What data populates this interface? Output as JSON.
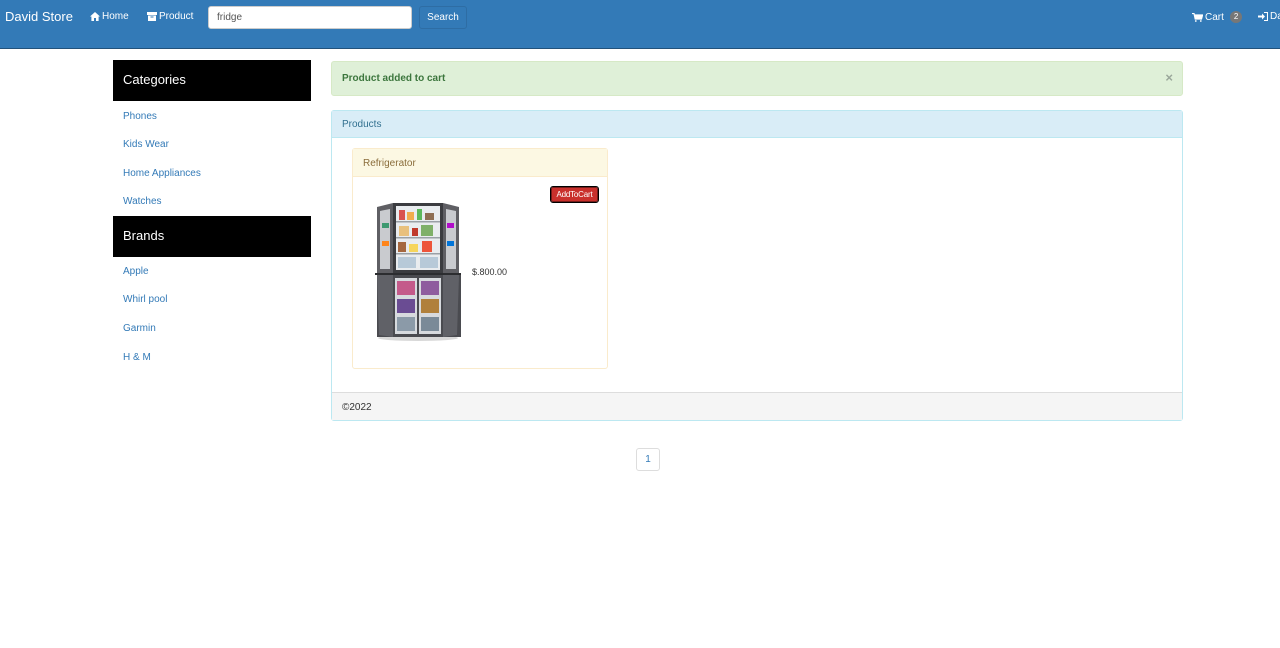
{
  "navbar": {
    "brand": "David Store",
    "home_label": "Home",
    "product_label": "Product",
    "search_value": "fridge",
    "search_button_label": "Search",
    "cart_label": "Cart",
    "cart_count": "2",
    "account_label": "Da"
  },
  "sidebar": {
    "categories_title": "Categories",
    "categories": [
      "Phones",
      "Kids Wear",
      "Home Appliances",
      "Watches"
    ],
    "brands_title": "Brands",
    "brands": [
      "Apple",
      "Whirl pool",
      "Garmin",
      "H & M"
    ]
  },
  "alert": {
    "message": "Product added to cart",
    "close": "×"
  },
  "products_panel": {
    "title": "Products",
    "footer": "©2022",
    "items": [
      {
        "name": "Refrigerator",
        "button_label": "AddToCart",
        "price": "$.800.00"
      }
    ]
  },
  "pagination": {
    "pages": [
      "1"
    ]
  },
  "colors": {
    "navbar": "#337ab7",
    "sidebar_header": "#000000",
    "alert_bg": "#dff0d8",
    "panel_heading": "#d9edf7",
    "card_heading": "#fcf8e3",
    "add_button": "#c9302c"
  },
  "icons": {
    "home": "home-icon",
    "product": "product-icon",
    "cart": "cart-icon",
    "login": "login-icon"
  }
}
